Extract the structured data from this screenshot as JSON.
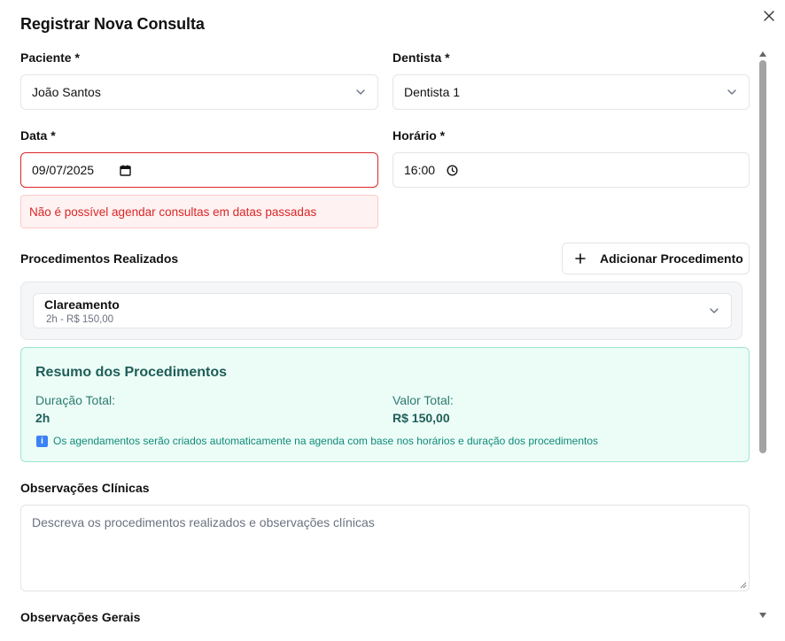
{
  "dialog": {
    "title": "Registrar Nova Consulta",
    "close_icon": "close-icon"
  },
  "form": {
    "patient": {
      "label": "Paciente *",
      "value": "João Santos"
    },
    "dentist": {
      "label": "Dentista *",
      "value": "Dentista 1"
    },
    "date": {
      "label": "Data *",
      "value": "09/07/2025",
      "error": "Não é possível agendar consultas em datas passadas"
    },
    "time": {
      "label": "Horário *",
      "value": "16:00"
    },
    "procedures": {
      "label": "Procedimentos Realizados",
      "add_button": "Adicionar Procedimento",
      "items": [
        {
          "name": "Clareamento",
          "detail": "2h - R$ 150,00"
        }
      ]
    },
    "summary": {
      "title": "Resumo dos Procedimentos",
      "duration_label": "Duração Total:",
      "duration_value": "2h",
      "total_label": "Valor Total:",
      "total_value": "R$ 150,00",
      "info": "Os agendamentos serão criados automaticamente na agenda com base nos horários e duração dos procedimentos"
    },
    "clinical_notes": {
      "label": "Observações Clínicas",
      "placeholder": "Descreva os procedimentos realizados e observações clínicas"
    },
    "general_notes": {
      "label": "Observações Gerais"
    }
  },
  "colors": {
    "error": "#dc2626",
    "summary_bg": "#ecfdf7",
    "summary_border": "#9ee5d3",
    "summary_text": "#1f5e58"
  }
}
